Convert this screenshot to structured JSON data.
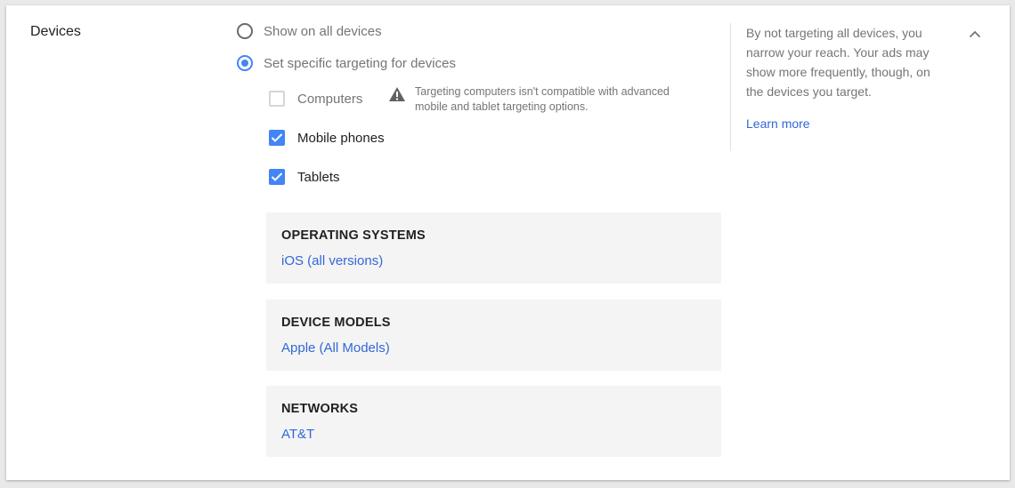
{
  "section": {
    "label": "Devices"
  },
  "radios": {
    "all_devices": {
      "label": "Show on all devices",
      "checked": false
    },
    "specific": {
      "label": "Set specific targeting for devices",
      "checked": true
    }
  },
  "devices": {
    "computers": {
      "label": "Computers",
      "checked": false
    },
    "mobile": {
      "label": "Mobile phones",
      "checked": true
    },
    "tablets": {
      "label": "Tablets",
      "checked": true
    }
  },
  "warning": {
    "icon": "warning-icon",
    "text": "Targeting computers isn't compatible with advanced mobile and tablet targeting options."
  },
  "panels": {
    "os": {
      "title": "OPERATING SYSTEMS",
      "value": "iOS (all versions)"
    },
    "models": {
      "title": "DEVICE MODELS",
      "value": "Apple (All Models)"
    },
    "networks": {
      "title": "NETWORKS",
      "value": "AT&T"
    }
  },
  "side": {
    "text": "By not targeting all devices, you narrow your reach. Your ads may show more frequently, though, on the devices you target.",
    "link": "Learn more"
  },
  "colors": {
    "accent": "#4285f4",
    "link": "#3367d6",
    "panel_bg": "#f4f4f4"
  },
  "icons": {
    "collapse": "chevron-up-icon",
    "check": "check-icon"
  }
}
